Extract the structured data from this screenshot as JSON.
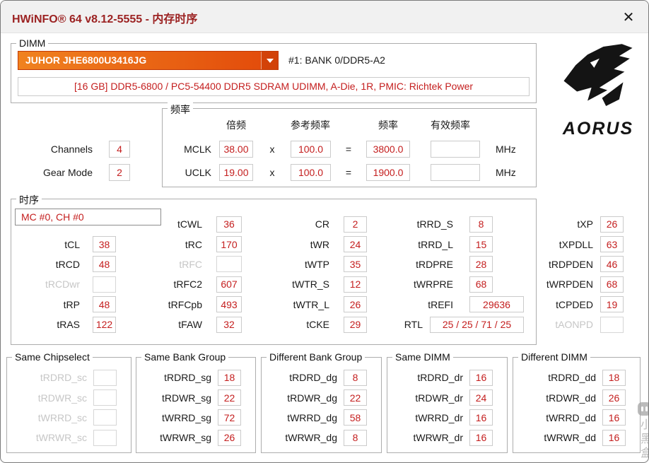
{
  "window": {
    "title": "HWiNFO® 64 v8.12-5555 - 内存时序",
    "close_glyph": "✕"
  },
  "dimm": {
    "group_label": "DIMM",
    "module_selector": "JUHOR JHE6800U3416JG",
    "slot_info": "#1: BANK 0/DDR5-A2",
    "module_details": "[16 GB] DDR5-6800 / PC5-54400 DDR5 SDRAM UDIMM, A-Die, 1R, PMIC: Richtek Power"
  },
  "brand": {
    "name": "AORUS"
  },
  "left_info": {
    "channels_label": "Channels",
    "channels_value": "4",
    "gear_mode_label": "Gear Mode",
    "gear_mode_value": "2"
  },
  "frequency": {
    "group_label": "频率",
    "headers": {
      "multiplier": "倍频",
      "reference": "参考频率",
      "frequency": "频率",
      "effective": "有效频率"
    },
    "times": "x",
    "equals": "=",
    "unit": "MHz",
    "rows": [
      {
        "label": "MCLK",
        "multiplier": "38.00",
        "reference": "100.0",
        "frequency": "3800.0",
        "effective": ""
      },
      {
        "label": "UCLK",
        "multiplier": "19.00",
        "reference": "100.0",
        "frequency": "1900.0",
        "effective": ""
      }
    ]
  },
  "timings": {
    "group_label": "时序",
    "channel_selector": "MC #0, CH #0",
    "col1": [
      {
        "label": "tCL",
        "value": "38"
      },
      {
        "label": "tRCD",
        "value": "48"
      },
      {
        "label": "tRCDwr",
        "value": ""
      },
      {
        "label": "tRP",
        "value": "48"
      },
      {
        "label": "tRAS",
        "value": "122"
      }
    ],
    "col2": [
      {
        "label": "tCWL",
        "value": "36"
      },
      {
        "label": "tRC",
        "value": "170"
      },
      {
        "label": "tRFC",
        "value": ""
      },
      {
        "label": "tRFC2",
        "value": "607"
      },
      {
        "label": "tRFCpb",
        "value": "493"
      },
      {
        "label": "tFAW",
        "value": "32"
      }
    ],
    "col3": [
      {
        "label": "CR",
        "value": "2"
      },
      {
        "label": "tWR",
        "value": "24"
      },
      {
        "label": "tWTP",
        "value": "35"
      },
      {
        "label": "tWTR_S",
        "value": "12"
      },
      {
        "label": "tWTR_L",
        "value": "26"
      },
      {
        "label": "tCKE",
        "value": "29"
      }
    ],
    "col4": [
      {
        "label": "tRRD_S",
        "value": "8"
      },
      {
        "label": "tRRD_L",
        "value": "15"
      },
      {
        "label": "tRDPRE",
        "value": "28"
      },
      {
        "label": "tWRPRE",
        "value": "68"
      },
      {
        "label": "tREFI",
        "value": "29636"
      },
      {
        "label": "RTL",
        "value": "25 / 25 / 71 / 25"
      }
    ],
    "col5": [
      {
        "label": "tXP",
        "value": "26"
      },
      {
        "label": "tXPDLL",
        "value": "63"
      },
      {
        "label": "tRDPDEN",
        "value": "46"
      },
      {
        "label": "tWRPDEN",
        "value": "68"
      },
      {
        "label": "tCPDED",
        "value": "19"
      },
      {
        "label": "tAONPD",
        "value": ""
      }
    ]
  },
  "bottom_groups": [
    {
      "title": "Same Chipselect",
      "rows": [
        {
          "label": "tRDRD_sc",
          "value": ""
        },
        {
          "label": "tRDWR_sc",
          "value": ""
        },
        {
          "label": "tWRRD_sc",
          "value": ""
        },
        {
          "label": "tWRWR_sc",
          "value": ""
        }
      ]
    },
    {
      "title": "Same Bank Group",
      "rows": [
        {
          "label": "tRDRD_sg",
          "value": "18"
        },
        {
          "label": "tRDWR_sg",
          "value": "22"
        },
        {
          "label": "tWRRD_sg",
          "value": "72"
        },
        {
          "label": "tWRWR_sg",
          "value": "26"
        }
      ]
    },
    {
      "title": "Different Bank Group",
      "rows": [
        {
          "label": "tRDRD_dg",
          "value": "8"
        },
        {
          "label": "tRDWR_dg",
          "value": "22"
        },
        {
          "label": "tWRRD_dg",
          "value": "58"
        },
        {
          "label": "tWRWR_dg",
          "value": "8"
        }
      ]
    },
    {
      "title": "Same DIMM",
      "rows": [
        {
          "label": "tRDRD_dr",
          "value": "16"
        },
        {
          "label": "tRDWR_dr",
          "value": "24"
        },
        {
          "label": "tWRRD_dr",
          "value": "16"
        },
        {
          "label": "tWRWR_dr",
          "value": "16"
        }
      ]
    },
    {
      "title": "Different DIMM",
      "rows": [
        {
          "label": "tRDRD_dd",
          "value": "18"
        },
        {
          "label": "tRDWR_dd",
          "value": "26"
        },
        {
          "label": "tWRRD_dd",
          "value": "16"
        },
        {
          "label": "tWRWR_dd",
          "value": "16"
        }
      ]
    }
  ],
  "watermark": {
    "text": "小黑盒"
  }
}
